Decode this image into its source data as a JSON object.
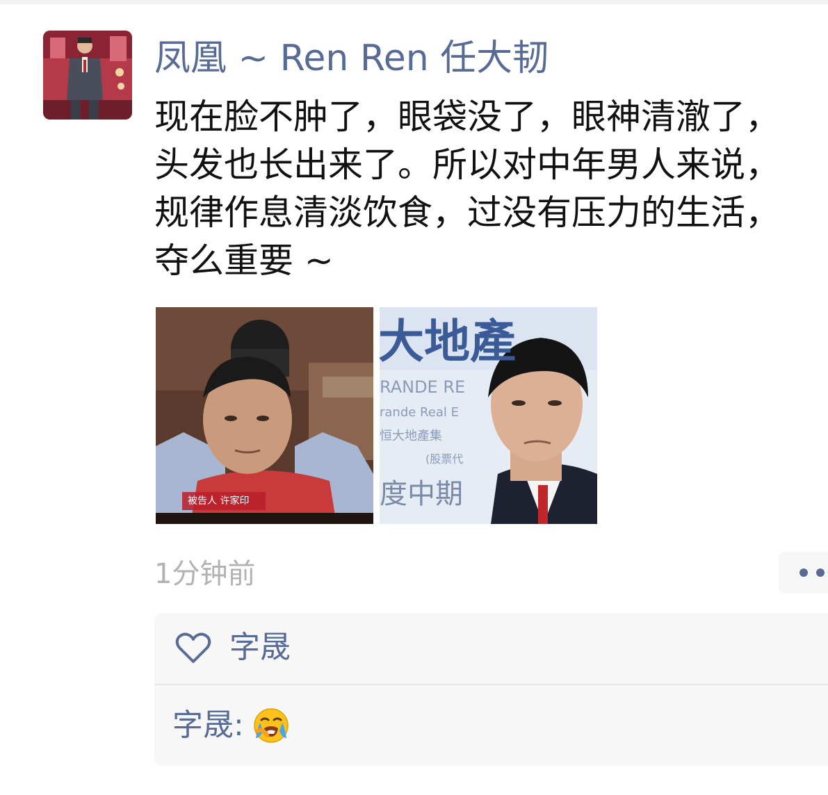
{
  "post": {
    "author": "凤凰 ~ Ren Ren 任大韧",
    "text_lines": [
      "现在脸不肿了，眼袋没了，眼神清澈了，",
      "头发也长出来了。所以对中年男人来说，",
      "规律作息清淡饮食，过没有压力的生活，",
      "夺么重要 ~"
    ],
    "timestamp": "1分钟前",
    "photos": [
      {
        "caption": "被告人 许家印"
      },
      {
        "background_text_1": "大地產",
        "background_text_2": "RANDE RE",
        "background_text_3": "rande Real E",
        "background_text_4": "恒大地產集",
        "background_text_5": "(股票代",
        "background_text_6": "度中期"
      }
    ]
  },
  "likes": {
    "names": "字晟"
  },
  "comments": [
    {
      "author": "字晟",
      "separator": ":",
      "emoji": "loudly-crying-face"
    }
  ],
  "colors": {
    "link": "#576b95",
    "text": "#111111",
    "meta": "#b2b2b2",
    "panel": "#f7f7f7"
  }
}
